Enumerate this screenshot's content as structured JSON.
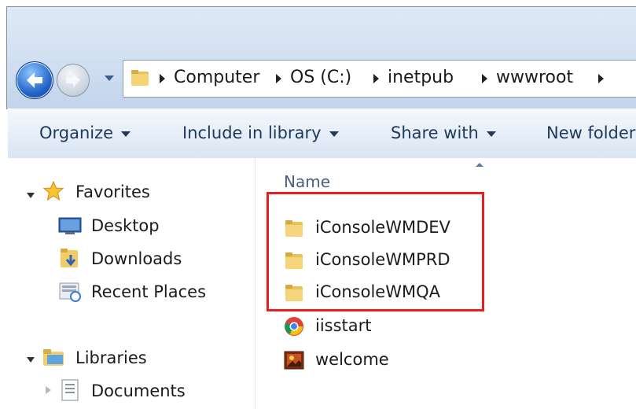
{
  "address_bar": {
    "crumbs": [
      "Computer",
      "OS (C:)",
      "inetpub",
      "wwwroot"
    ]
  },
  "toolbar": {
    "organize": "Organize",
    "include_in_library": "Include in library",
    "share_with": "Share with",
    "new_folder": "New folder"
  },
  "nav_pane": {
    "favorites": "Favorites",
    "desktop": "Desktop",
    "downloads": "Downloads",
    "recent_places": "Recent Places",
    "libraries": "Libraries",
    "documents": "Documents"
  },
  "content": {
    "column_name": "Name",
    "items": [
      {
        "name": "iConsoleWMDEV",
        "icon": "folder-icon"
      },
      {
        "name": "iConsoleWMPRD",
        "icon": "folder-icon"
      },
      {
        "name": "iConsoleWMQA",
        "icon": "folder-icon"
      },
      {
        "name": "iisstart",
        "icon": "chrome-html-icon"
      },
      {
        "name": "welcome",
        "icon": "image-file-icon"
      }
    ]
  },
  "colors": {
    "highlight_box": "#e62020",
    "toolbar_text": "#1e395b"
  }
}
